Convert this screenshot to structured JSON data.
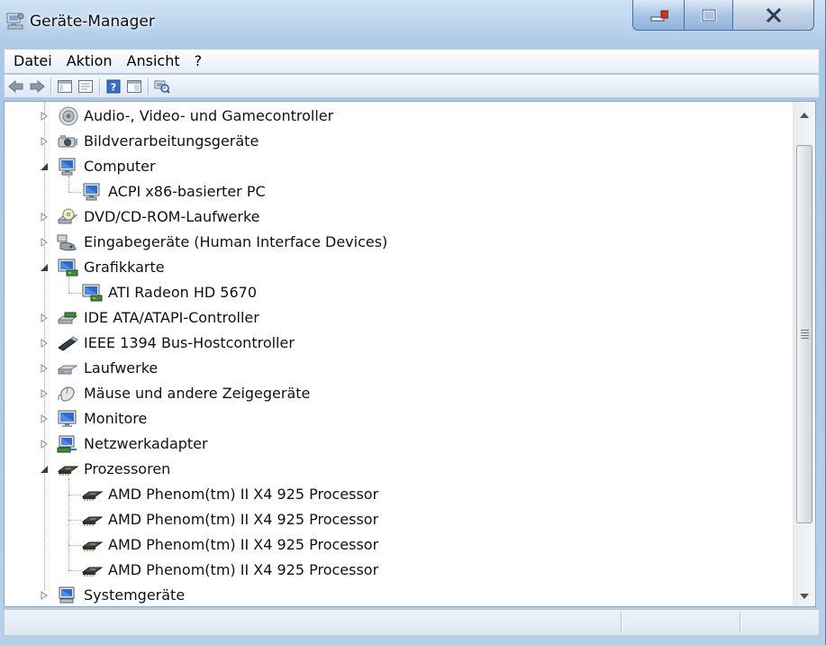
{
  "window": {
    "title": "Geräte-Manager",
    "icon": "device-manager-icon"
  },
  "title_buttons": [
    {
      "name": "minimize-button",
      "icon": "minimize-icon"
    },
    {
      "name": "maximize-button",
      "icon": "maximize-icon"
    },
    {
      "name": "close-button",
      "icon": "close-icon"
    }
  ],
  "menu": {
    "items": [
      "Datei",
      "Aktion",
      "Ansicht",
      "?"
    ]
  },
  "toolbar": {
    "buttons": [
      "back-icon",
      "forward-icon",
      "console-tree-icon",
      "properties-icon",
      "help-icon",
      "show-hide-icon",
      "scan-hardware-icon"
    ]
  },
  "tree": {
    "items": [
      {
        "label": "Audio-, Video- und Gamecontroller",
        "level": 0,
        "state": "collapsed",
        "icon": "speaker-icon"
      },
      {
        "label": "Bildverarbeitungsgeräte",
        "level": 0,
        "state": "collapsed",
        "icon": "camera-icon"
      },
      {
        "label": "Computer",
        "level": 0,
        "state": "expanded",
        "icon": "computer-icon"
      },
      {
        "label": "ACPI x86-basierter PC",
        "level": 1,
        "state": "leaf",
        "icon": "computer-icon"
      },
      {
        "label": "DVD/CD-ROM-Laufwerke",
        "level": 0,
        "state": "collapsed",
        "icon": "dvd-drive-icon"
      },
      {
        "label": "Eingabegeräte (Human Interface Devices)",
        "level": 0,
        "state": "collapsed",
        "icon": "hid-icon"
      },
      {
        "label": "Grafikkarte",
        "level": 0,
        "state": "expanded",
        "icon": "display-adapter-icon"
      },
      {
        "label": "ATI Radeon HD 5670",
        "level": 1,
        "state": "leaf",
        "icon": "display-adapter-icon"
      },
      {
        "label": "IDE ATA/ATAPI-Controller",
        "level": 0,
        "state": "collapsed",
        "icon": "ide-controller-icon"
      },
      {
        "label": "IEEE 1394 Bus-Hostcontroller",
        "level": 0,
        "state": "collapsed",
        "icon": "firewire-icon"
      },
      {
        "label": "Laufwerke",
        "level": 0,
        "state": "collapsed",
        "icon": "disk-drive-icon"
      },
      {
        "label": "Mäuse und andere Zeigegeräte",
        "level": 0,
        "state": "collapsed",
        "icon": "mouse-icon"
      },
      {
        "label": "Monitore",
        "level": 0,
        "state": "collapsed",
        "icon": "monitor-icon"
      },
      {
        "label": "Netzwerkadapter",
        "level": 0,
        "state": "collapsed",
        "icon": "network-adapter-icon"
      },
      {
        "label": "Prozessoren",
        "level": 0,
        "state": "expanded",
        "icon": "processor-icon"
      },
      {
        "label": "AMD Phenom(tm) II X4 925 Processor",
        "level": 1,
        "state": "leaf",
        "icon": "processor-icon"
      },
      {
        "label": "AMD Phenom(tm) II X4 925 Processor",
        "level": 1,
        "state": "leaf",
        "icon": "processor-icon"
      },
      {
        "label": "AMD Phenom(tm) II X4 925 Processor",
        "level": 1,
        "state": "leaf",
        "icon": "processor-icon"
      },
      {
        "label": "AMD Phenom(tm) II X4 925 Processor",
        "level": 1,
        "state": "leaf",
        "icon": "processor-icon"
      },
      {
        "label": "Systemgeräte",
        "level": 0,
        "state": "collapsed",
        "icon": "system-device-icon"
      }
    ]
  },
  "colors": {
    "tree_text": "#111111",
    "close_accent": "#c7352b"
  }
}
